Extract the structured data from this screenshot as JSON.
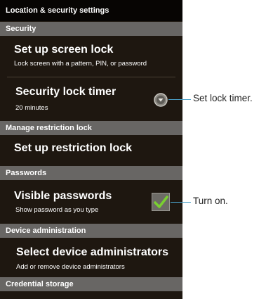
{
  "header": {
    "title": "Location & security settings"
  },
  "sections": {
    "security": "Security",
    "restriction": "Manage restriction lock",
    "passwords": "Passwords",
    "device_admin": "Device administration",
    "credential": "Credential storage"
  },
  "items": {
    "screen_lock": {
      "title": "Set up screen lock",
      "subtitle": "Lock screen with a pattern, PIN, or password"
    },
    "lock_timer": {
      "title": "Security lock timer",
      "subtitle": "20 minutes"
    },
    "restriction_lock": {
      "title": "Set up restriction lock"
    },
    "visible_passwords": {
      "title": "Visible passwords",
      "subtitle": "Show password as you type",
      "checked": true
    },
    "device_admins": {
      "title": "Select device administrators",
      "subtitle": "Add or remove device administrators"
    }
  },
  "callouts": {
    "lock_timer": "Set lock timer.",
    "visible_passwords": "Turn on."
  },
  "colors": {
    "background": "#1e1710",
    "section_header": "#686664",
    "checkmark": "#7ad030",
    "callout_line": "#4aa0c8"
  },
  "icons": {
    "lock_timer": "spinner-arrow-icon",
    "visible_passwords": "checkmark-icon"
  }
}
